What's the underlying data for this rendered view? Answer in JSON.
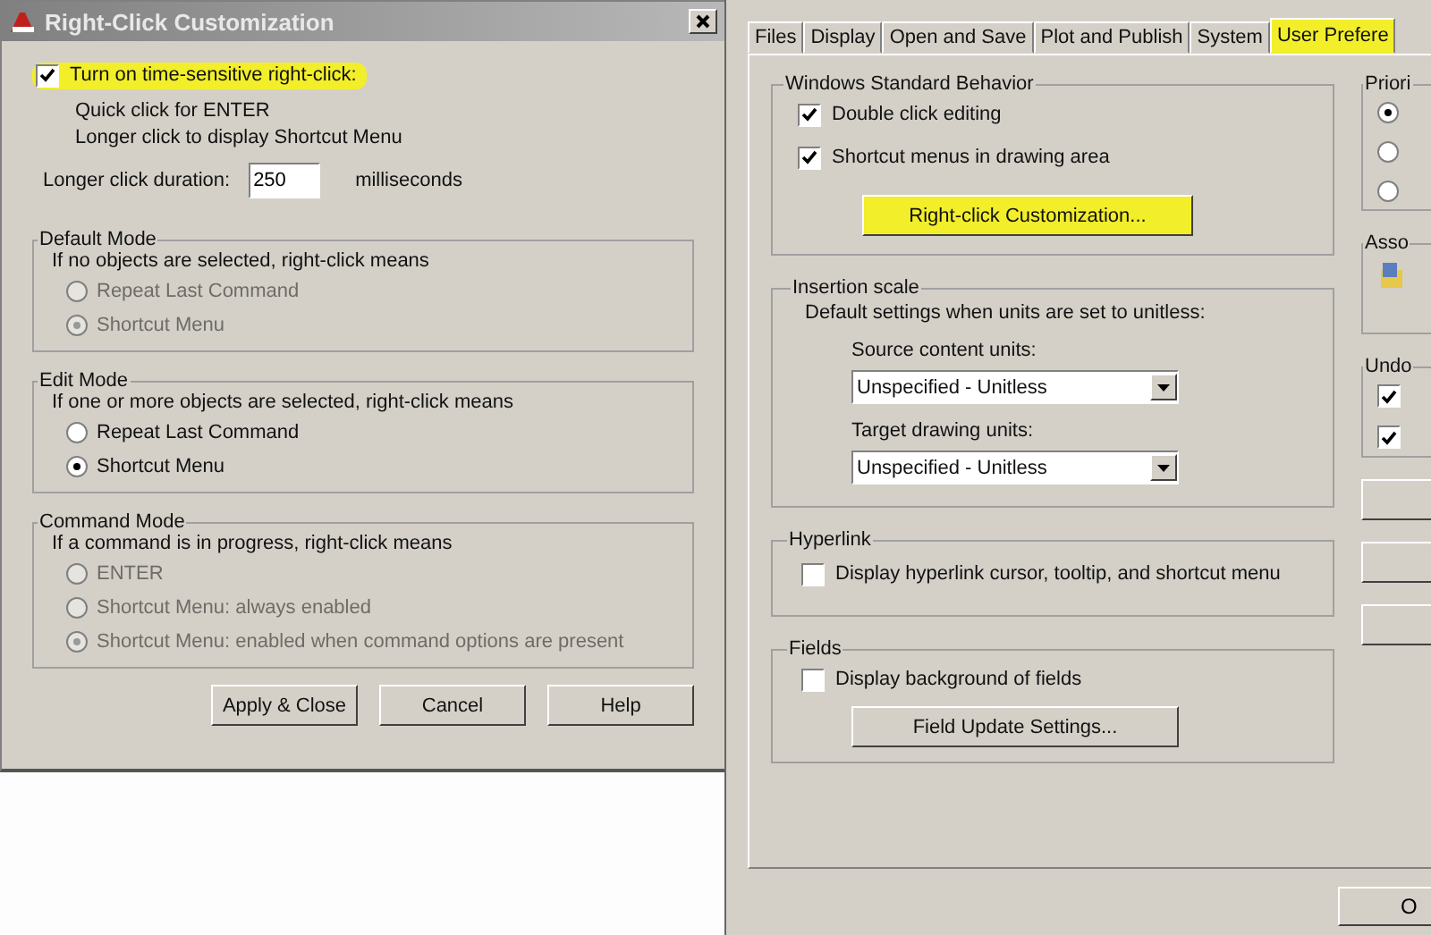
{
  "left_dialog": {
    "title": "Right-Click Customization",
    "time_sensitive": {
      "label": "Turn on time-sensitive right-click:",
      "checked": true,
      "highlighted": true
    },
    "notes": [
      "Quick click for ENTER",
      "Longer click to display Shortcut Menu"
    ],
    "duration": {
      "label": "Longer click duration:",
      "value": "250",
      "unit": "milliseconds"
    },
    "groups": [
      {
        "title": "Default Mode",
        "description": "If no objects are selected, right-click means",
        "disabled": true,
        "options": [
          {
            "label": "Repeat Last Command",
            "selected": false
          },
          {
            "label": "Shortcut Menu",
            "selected": true
          }
        ]
      },
      {
        "title": "Edit Mode",
        "description": "If one or more objects are selected, right-click means",
        "disabled": false,
        "options": [
          {
            "label": "Repeat Last Command",
            "selected": false
          },
          {
            "label": "Shortcut Menu",
            "selected": true
          }
        ]
      },
      {
        "title": "Command Mode",
        "description": "If a command is in progress, right-click means",
        "disabled": true,
        "options": [
          {
            "label": "ENTER",
            "selected": false
          },
          {
            "label": "Shortcut Menu: always enabled",
            "selected": false
          },
          {
            "label": "Shortcut Menu: enabled when command options are present",
            "selected": true
          }
        ]
      }
    ],
    "buttons": [
      {
        "label": "Apply & Close"
      },
      {
        "label": "Cancel"
      },
      {
        "label": "Help"
      }
    ]
  },
  "right_dialog": {
    "tabs": [
      {
        "label": "Files",
        "selected": false,
        "highlighted": false
      },
      {
        "label": "Display",
        "selected": false,
        "highlighted": false
      },
      {
        "label": "Open and Save",
        "selected": false,
        "highlighted": false
      },
      {
        "label": "Plot and Publish",
        "selected": false,
        "highlighted": false
      },
      {
        "label": "System",
        "selected": false,
        "highlighted": false
      },
      {
        "label": "User Prefere",
        "selected": true,
        "highlighted": true
      }
    ],
    "windows_behavior": {
      "title": "Windows Standard Behavior",
      "checkboxes": [
        {
          "label": "Double click editing",
          "checked": true
        },
        {
          "label": "Shortcut menus in drawing area",
          "checked": true
        }
      ],
      "button": {
        "label": "Right-click Customization...",
        "highlighted": true
      }
    },
    "insertion_scale": {
      "title": "Insertion scale",
      "description": "Default settings when units are set to unitless:",
      "fields": [
        {
          "label": "Source content units:",
          "value": "Unspecified - Unitless"
        },
        {
          "label": "Target drawing units:",
          "value": "Unspecified - Unitless"
        }
      ]
    },
    "hyperlink": {
      "title": "Hyperlink",
      "checkbox": {
        "label": "Display hyperlink cursor, tooltip, and shortcut menu",
        "checked": false
      }
    },
    "fields": {
      "title": "Fields",
      "checkbox": {
        "label": "Display background of fields",
        "checked": false
      },
      "button": {
        "label": "Field Update Settings..."
      }
    },
    "side_groups": [
      {
        "title": "Priori",
        "kind": "radios",
        "items": [
          {
            "selected": true
          },
          {
            "selected": false
          },
          {
            "selected": false
          }
        ]
      },
      {
        "title": "Asso",
        "kind": "icon"
      },
      {
        "title": "Undo",
        "kind": "checks",
        "items": [
          {
            "checked": true
          },
          {
            "checked": true
          }
        ]
      }
    ],
    "ok_button": {
      "label": "O"
    }
  }
}
